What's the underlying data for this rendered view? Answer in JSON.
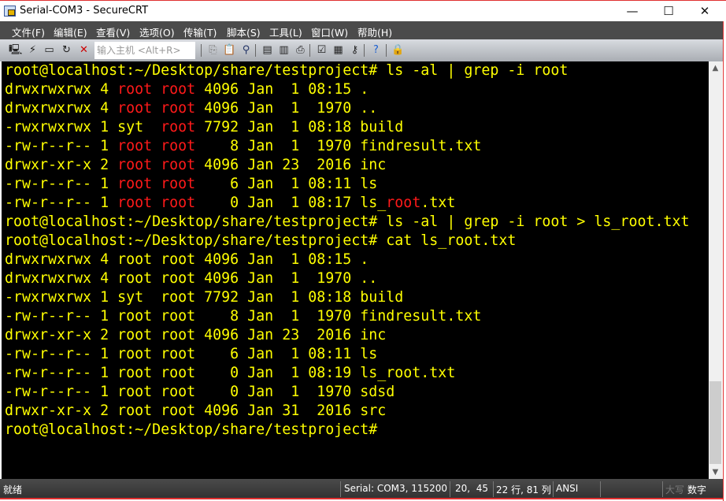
{
  "window": {
    "title": "Serial-COM3 - SecureCRT",
    "minimize": "—",
    "maximize": "☐",
    "close": "✕"
  },
  "menu": [
    "文件(F)",
    "编辑(E)",
    "查看(V)",
    "选项(O)",
    "传输(T)",
    "脚本(S)",
    "工具(L)",
    "窗口(W)",
    "帮助(H)"
  ],
  "toolbar": {
    "host_placeholder": "输入主机 <Alt+R>",
    "icons": [
      "connect-icon",
      "quick-connect-icon",
      "connect-tab-icon",
      "reconnect-icon",
      "disconnect-icon",
      "copy-icon",
      "paste-icon",
      "find-icon",
      "print-setup-icon",
      "print-selection-icon",
      "print-icon",
      "session-options-icon",
      "keymap-icon",
      "key-icon",
      "help-icon",
      "lock-icon"
    ]
  },
  "colors": {
    "yellow": "#ffff00",
    "red": "#ff1a1a",
    "background": "#000000"
  },
  "terminal": {
    "lines": [
      [
        [
          "y",
          "root@localhost:~/Desktop/share/testproject# ls -al | grep -i root"
        ]
      ],
      [
        [
          "y",
          "drwxrwxrwx 4 "
        ],
        [
          "r",
          "root root"
        ],
        [
          "y",
          " 4096 Jan  1 08:15 ."
        ]
      ],
      [
        [
          "y",
          "drwxrwxrwx 4 "
        ],
        [
          "r",
          "root root"
        ],
        [
          "y",
          " 4096 Jan  1  1970 .."
        ]
      ],
      [
        [
          "y",
          "-rwxrwxrwx 1 syt  "
        ],
        [
          "r",
          "root"
        ],
        [
          "y",
          " 7792 Jan  1 08:18 build"
        ]
      ],
      [
        [
          "y",
          "-rw-r--r-- 1 "
        ],
        [
          "r",
          "root root"
        ],
        [
          "y",
          "    8 Jan  1  1970 findresult.txt"
        ]
      ],
      [
        [
          "y",
          "drwxr-xr-x 2 "
        ],
        [
          "r",
          "root root"
        ],
        [
          "y",
          " 4096 Jan 23  2016 inc"
        ]
      ],
      [
        [
          "y",
          "-rw-r--r-- 1 "
        ],
        [
          "r",
          "root root"
        ],
        [
          "y",
          "    6 Jan  1 08:11 ls"
        ]
      ],
      [
        [
          "y",
          "-rw-r--r-- 1 "
        ],
        [
          "r",
          "root root"
        ],
        [
          "y",
          "    0 Jan  1 08:17 ls_"
        ],
        [
          "r",
          "root"
        ],
        [
          "y",
          ".txt"
        ]
      ],
      [
        [
          "y",
          "root@localhost:~/Desktop/share/testproject# ls -al | grep -i root > ls_root.txt"
        ]
      ],
      [
        [
          "y",
          "root@localhost:~/Desktop/share/testproject# cat ls_root.txt"
        ]
      ],
      [
        [
          "y",
          "drwxrwxrwx 4 root root 4096 Jan  1 08:15 ."
        ]
      ],
      [
        [
          "y",
          "drwxrwxrwx 4 root root 4096 Jan  1  1970 .."
        ]
      ],
      [
        [
          "y",
          "-rwxrwxrwx 1 syt  root 7792 Jan  1 08:18 build"
        ]
      ],
      [
        [
          "y",
          "-rw-r--r-- 1 root root    8 Jan  1  1970 findresult.txt"
        ]
      ],
      [
        [
          "y",
          "drwxr-xr-x 2 root root 4096 Jan 23  2016 inc"
        ]
      ],
      [
        [
          "y",
          "-rw-r--r-- 1 root root    6 Jan  1 08:11 ls"
        ]
      ],
      [
        [
          "y",
          "-rw-r--r-- 1 root root    0 Jan  1 08:19 ls_root.txt"
        ]
      ],
      [
        [
          "y",
          "-rw-r--r-- 1 root root    0 Jan  1  1970 sdsd"
        ]
      ],
      [
        [
          "y",
          "drwxr-xr-x 2 root root 4096 Jan 31  2016 src"
        ]
      ],
      [
        [
          "y",
          "root@localhost:~/Desktop/share/testproject#"
        ]
      ]
    ]
  },
  "status": {
    "ready": "就绪",
    "connection": "Serial: COM3, 115200",
    "cursor": "20,  45",
    "size": "22 行, 81 列",
    "encoding": "ANSI",
    "caps": "大写",
    "num": "数字"
  }
}
